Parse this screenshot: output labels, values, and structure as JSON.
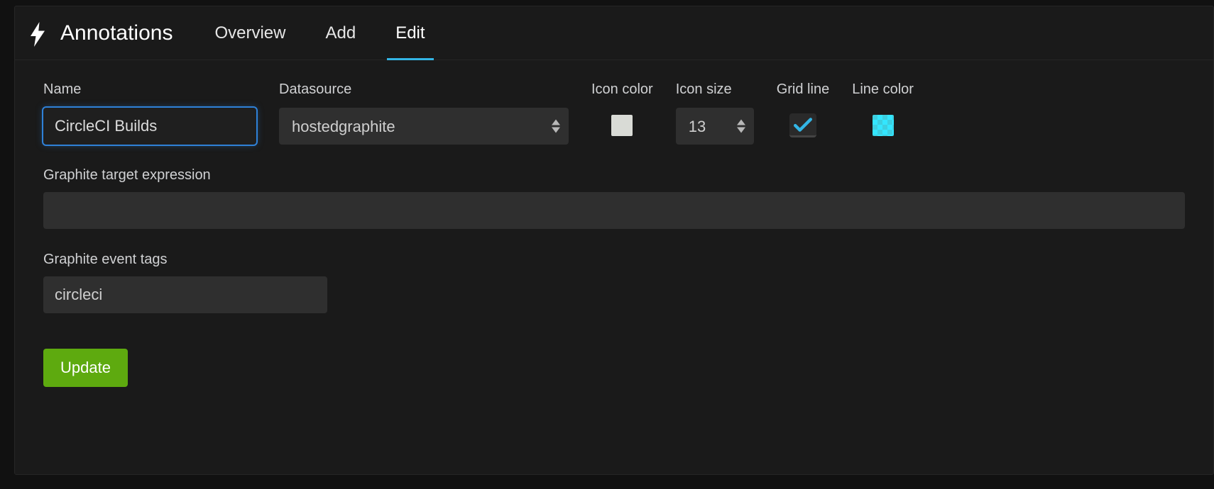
{
  "header": {
    "title": "Annotations",
    "tabs": {
      "overview": "Overview",
      "add": "Add",
      "edit": "Edit"
    },
    "active_tab": "edit"
  },
  "form": {
    "name": {
      "label": "Name",
      "value": "CircleCI Builds"
    },
    "datasource": {
      "label": "Datasource",
      "value": "hostedgraphite"
    },
    "icon_color": {
      "label": "Icon color",
      "value": "#d9dbd6"
    },
    "icon_size": {
      "label": "Icon size",
      "value": "13"
    },
    "grid_line": {
      "label": "Grid line",
      "checked": true
    },
    "line_color": {
      "label": "Line color",
      "value": "#40e0ff"
    },
    "target_expr": {
      "label": "Graphite target expression",
      "value": ""
    },
    "event_tags": {
      "label": "Graphite event tags",
      "value": "circleci"
    }
  },
  "buttons": {
    "update": "Update"
  }
}
